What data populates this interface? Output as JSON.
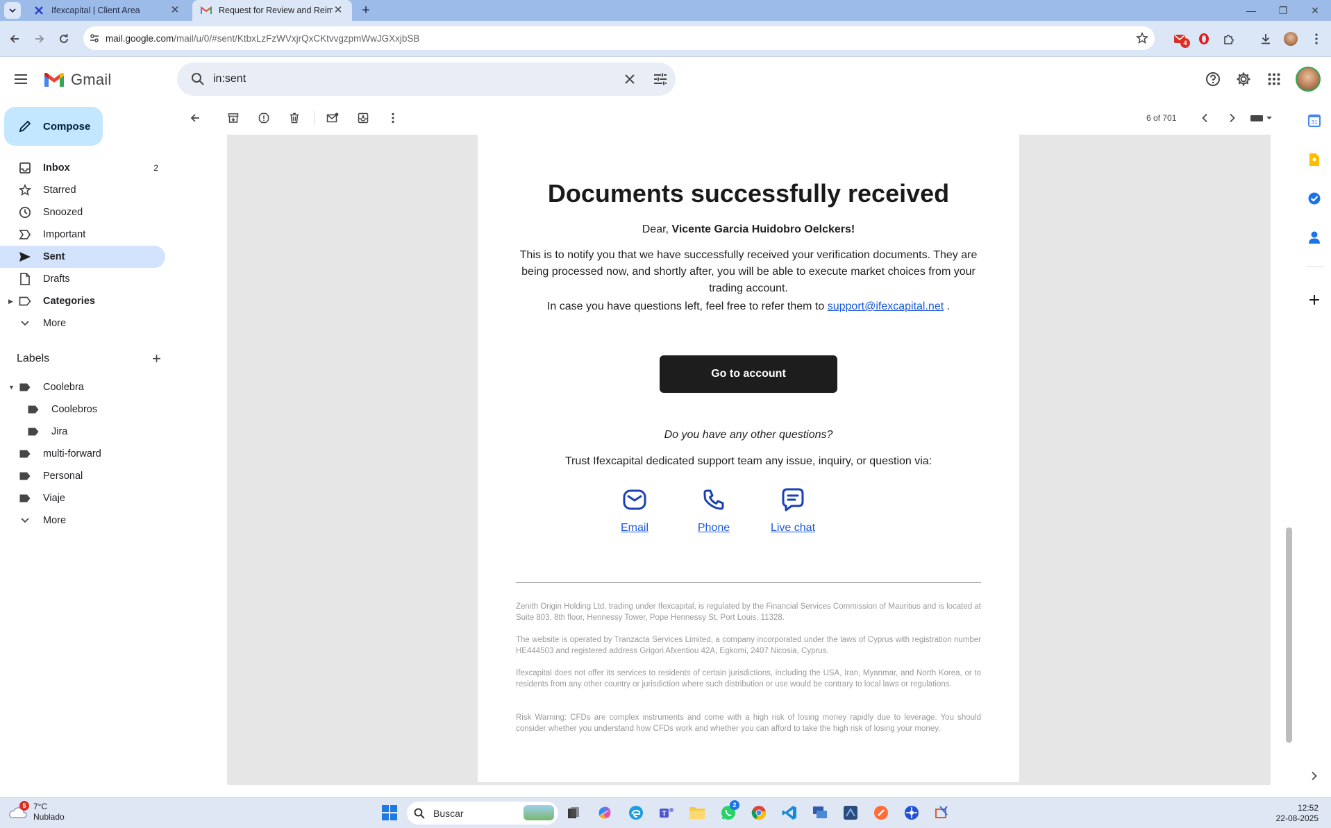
{
  "browser": {
    "tabs": [
      {
        "title": "Ifexcapital | Client Area"
      },
      {
        "title": "Request for Review and Reimbu"
      }
    ],
    "url_host": "mail.google.com",
    "url_path": "/mail/u/0/#sent/KtbxLzFzWVxjrQxCKtvvgzpmWwJGXxjbSB",
    "ext_badge": "4"
  },
  "gmail": {
    "brand": "Gmail",
    "search_value": "in:sent",
    "compose_label": "Compose",
    "nav": [
      {
        "label": "Inbox",
        "count": "2"
      },
      {
        "label": "Starred",
        "count": ""
      },
      {
        "label": "Snoozed",
        "count": ""
      },
      {
        "label": "Important",
        "count": ""
      },
      {
        "label": "Sent",
        "count": ""
      },
      {
        "label": "Drafts",
        "count": ""
      },
      {
        "label": "Categories",
        "count": ""
      },
      {
        "label": "More",
        "count": ""
      }
    ],
    "labels_title": "Labels",
    "labels": [
      {
        "label": "Coolebra"
      },
      {
        "label": "Coolebros"
      },
      {
        "label": "Jira"
      },
      {
        "label": "multi-forward"
      },
      {
        "label": "Personal"
      },
      {
        "label": "Viaje"
      },
      {
        "label": "More"
      }
    ],
    "pager": "6 of 701"
  },
  "email": {
    "title": "Documents successfully received",
    "dear_prefix": "Dear, ",
    "recipient_name": "Vicente Garcia Huidobro Oelckers",
    "dear_suffix": "!",
    "para1": "This is to notify you that we have successfully received your verification documents. They are being processed now, and shortly after, you will be able to execute market choices from your trading account.",
    "para2_prefix": "In case you have questions left, feel free to refer them to ",
    "support_email": "support@ifexcapital.net",
    "para2_suffix": " .",
    "button": "Go to account",
    "question": "Do you have any other questions?",
    "trust": "Trust Ifexcapital dedicated support team any issue, inquiry, or question via:",
    "contacts": [
      {
        "label": "Email",
        "icon": "envelope-icon"
      },
      {
        "label": "Phone",
        "icon": "phone-icon"
      },
      {
        "label": "Live chat",
        "icon": "chat-icon"
      }
    ],
    "footer": [
      "Zenith Origin Holding Ltd, trading under Ifexcapital, is regulated by the Financial Services Commission of Mauritius and is located at Suite 803, 8th floor, Hennessy Tower, Pope Hennessy St, Port Louis, 11328.",
      "The website is operated by Tranzacta Services Limited, a company incorporated under the laws of Cyprus with registration number HE444503 and registered address Grigori Afxentiou 42A, Egkomi, 2407 Nicosia, Cyprus.",
      "Ifexcapital does not offer its services to residents of certain jurisdictions, including the USA, Iran, Myanmar, and North Korea, or to residents from any other country or jurisdiction where such distribution or use would be contrary to local laws or regulations.",
      "Risk Warning: CFDs are complex instruments and come with a high risk of losing money rapidly due to leverage. You should consider whether you understand how CFDs work and whether you can afford to take the high risk of losing your money."
    ],
    "link_color": "#1a58d9",
    "button_color": "#1d1d1d"
  },
  "taskbar": {
    "weather_badge": "5",
    "temperature": "7°C",
    "condition": "Nublado",
    "search_placeholder": "Buscar",
    "whatsapp_badge": "2",
    "time": "12:52",
    "date": "22-08-2025"
  },
  "colors": {
    "sent_highlight": "#d3e3fd",
    "compose_bg": "#c2e7ff",
    "tab_strip": "#9cbbe9"
  }
}
